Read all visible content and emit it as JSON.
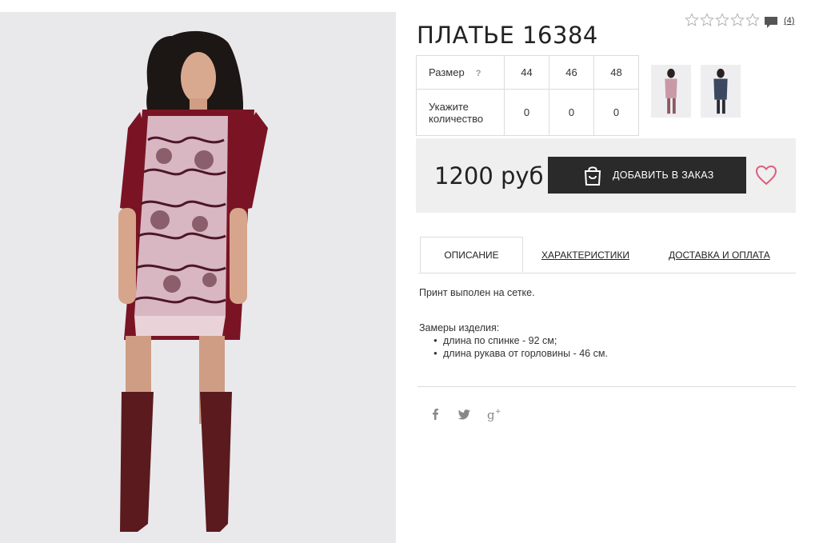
{
  "product": {
    "title": "ПЛАТЬЕ 16384",
    "comment_count": "(4)"
  },
  "sizes": {
    "size_label": "Размер",
    "help": "?",
    "quantity_label_line1": "Укажите",
    "quantity_label_line2": "количество",
    "columns": [
      "44",
      "46",
      "48"
    ],
    "quantities": [
      "0",
      "0",
      "0"
    ]
  },
  "purchase": {
    "price": "1200 руб",
    "add_button": "ДОБАВИТЬ В ЗАКАЗ"
  },
  "tabs": {
    "description": "ОПИСАНИЕ",
    "characteristics": "ХАРАКТЕРИСТИКИ",
    "delivery": "ДОСТАВКА И ОПЛАТА"
  },
  "description": {
    "text": "Принт выполен на сетке.",
    "measures_title": "Замеры изделия:",
    "measures": [
      "длина по спинке - 92 см;",
      "длина рукава от горловины - 46 см."
    ]
  },
  "colors": {
    "button_bg": "#2a2a2a",
    "heart": "#d8607a",
    "buybox_bg": "#efefef",
    "dress": "#7a1424"
  },
  "icons": [
    "star-icon",
    "comment-icon",
    "shopping-bag-icon",
    "heart-icon",
    "facebook-icon",
    "twitter-icon",
    "google-plus-icon"
  ]
}
